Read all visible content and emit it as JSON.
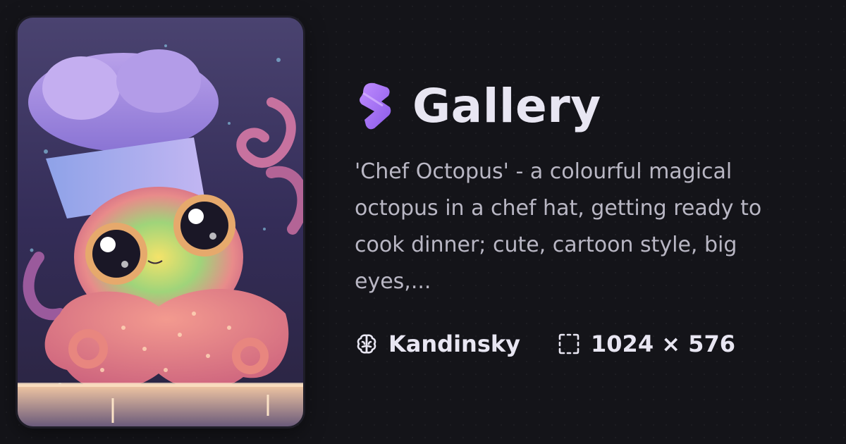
{
  "title": "Gallery",
  "description": "'Chef Octopus' - a colourful magical octopus in a chef hat, getting ready to cook dinner; cute, cartoon style, big eyes,...",
  "model": {
    "icon": "brain-icon",
    "label": "Kandinsky"
  },
  "dimensions": {
    "icon": "resize-frame-icon",
    "label": "1024 × 576"
  },
  "colors": {
    "background": "#141419",
    "accent": "#a26cf5",
    "title": "#e8e6f2",
    "body": "#b9b7c4"
  }
}
